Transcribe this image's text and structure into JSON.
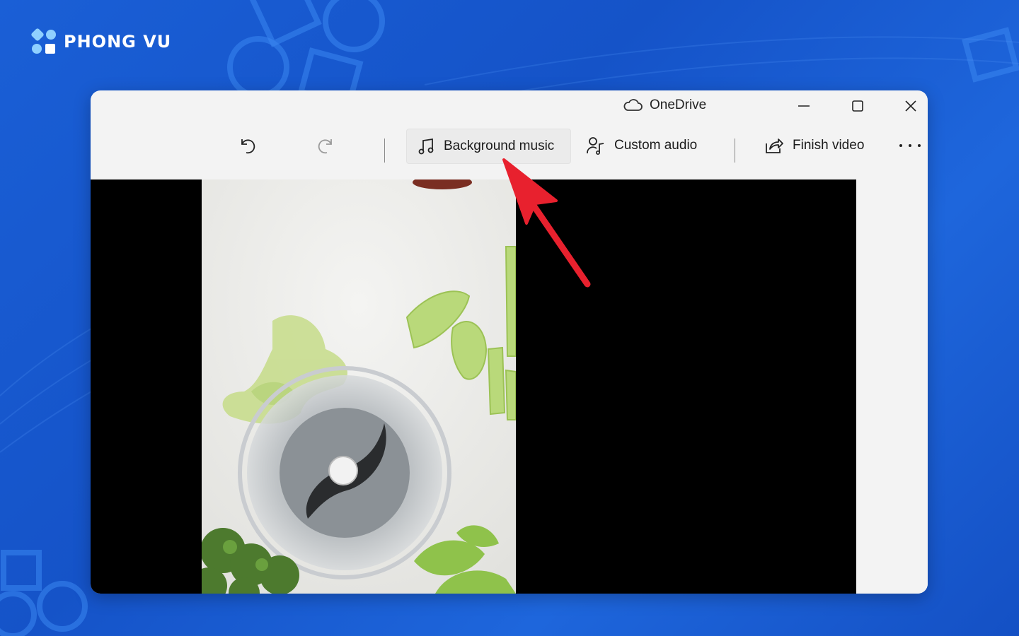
{
  "brand": {
    "name": "PHONG VU"
  },
  "window": {
    "cloud_label": "OneDrive",
    "controls": {
      "minimize": "minimize-icon",
      "maximize": "maximize-icon",
      "close": "close-icon"
    }
  },
  "toolbar": {
    "undo_icon": "undo-icon",
    "redo_icon": "redo-icon",
    "background_music_label": "Background music",
    "custom_audio_label": "Custom audio",
    "finish_video_label": "Finish video",
    "more_icon": "more-icon"
  },
  "colors": {
    "background": "#1a5fd6",
    "window": "#f3f3f3",
    "annotation_arrow": "#e8212e",
    "preview": "#000000"
  }
}
